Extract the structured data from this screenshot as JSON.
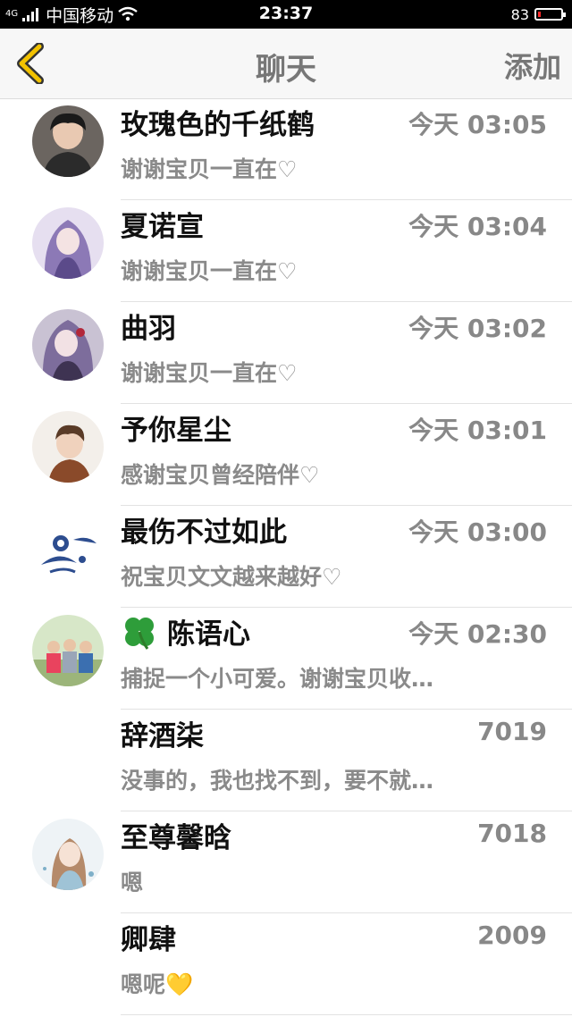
{
  "status_bar": {
    "network": "4G",
    "carrier": "中国移动",
    "time": "23:37",
    "battery_label": "83",
    "battery_level": 0.12
  },
  "nav": {
    "back_icon": "chevron-left-icon",
    "title": "聊天",
    "add_label": "添加"
  },
  "chats": [
    {
      "name": "玫瑰色的千纸鹤",
      "time": "今天 03:05",
      "message": "谢谢宝贝一直在♡"
    },
    {
      "name": "夏诺宣",
      "time": "今天 03:04",
      "message": "谢谢宝贝一直在♡"
    },
    {
      "name": "曲羽",
      "time": "今天 03:02",
      "message": "谢谢宝贝一直在♡"
    },
    {
      "name": "予你星尘",
      "time": "今天 03:01",
      "message": "感谢宝贝曾经陪伴♡"
    },
    {
      "name": "最伤不过如此",
      "time": "今天 03:00",
      "message": "祝宝贝文文越来越好♡"
    },
    {
      "name": "陈语心",
      "time": "今天 02:30",
      "message": "捕捉一个小可爱。谢谢宝贝收…"
    },
    {
      "name": "辞酒柒",
      "time": "7019",
      "message": "没事的，我也找不到，要不就…"
    },
    {
      "name": "至尊馨晗",
      "time": "7018",
      "message": "嗯"
    },
    {
      "name": "卿肆",
      "time": "2009",
      "message": "嗯呢💛"
    }
  ],
  "colors": {
    "status_bg": "#000000",
    "nav_bg": "#f7f7f7",
    "accent_yellow": "#f2c200",
    "battery_low": "#ff2a2a"
  }
}
